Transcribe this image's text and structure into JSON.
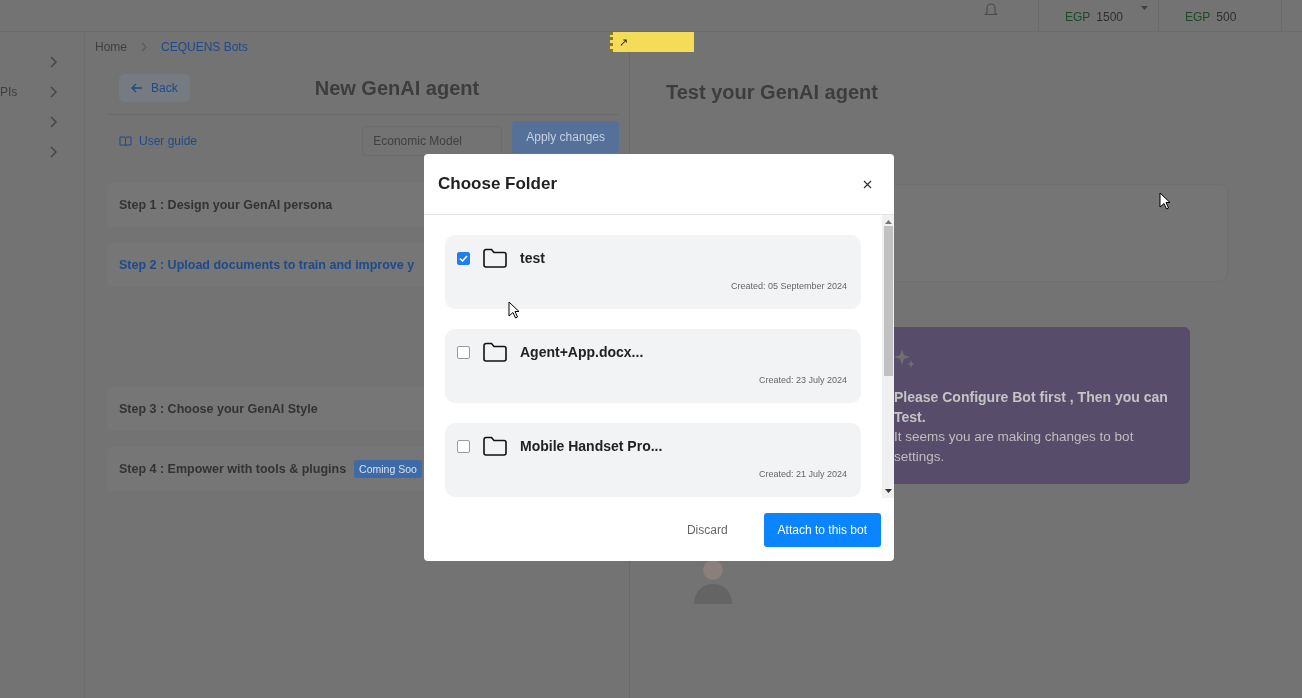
{
  "header": {
    "balances": [
      {
        "currency": "EGP",
        "amount": "1500",
        "dropdown": true
      },
      {
        "currency": "EGP",
        "amount": "500",
        "dropdown": false
      }
    ]
  },
  "sidebar": {
    "items": [
      {
        "kind": "chevron"
      },
      {
        "kind": "labeled",
        "label": "PIs"
      },
      {
        "kind": "chevron"
      },
      {
        "kind": "chevron"
      }
    ]
  },
  "sticky_note": {
    "text": "↗"
  },
  "breadcrumb": [
    {
      "label": "Home",
      "current": false
    },
    {
      "label": "CEQUENS Bots",
      "current": true
    }
  ],
  "editor": {
    "back": "Back",
    "title": "New GenAI agent",
    "user_guide": "User guide",
    "model": "Economic Model",
    "apply": "Apply changes",
    "steps": [
      {
        "label": "Step 1 : Design your GenAI persona",
        "active": false
      },
      {
        "label": "Step 2 : Upload documents to train and improve y",
        "active": true
      },
      {
        "label": "Step 3 : Choose your GenAI Style",
        "active": false
      },
      {
        "label": "Step 4 : Empower with tools & plugins",
        "active": false,
        "badge": "Coming Soo"
      }
    ]
  },
  "test_panel": {
    "title": "Test your GenAI agent",
    "notice": {
      "heading": "Please Configure Bot first , Then you can Test.",
      "body": "It seems you are making changes to bot settings."
    }
  },
  "dialog": {
    "title": "Choose Folder",
    "folders": [
      {
        "name": "test",
        "created": "Created: 05 September 2024",
        "checked": true
      },
      {
        "name": "Agent+App.docx...",
        "created": "Created: 23 July 2024",
        "checked": false
      },
      {
        "name": "Mobile Handset Pro...",
        "created": "Created: 21 July 2024",
        "checked": false
      }
    ],
    "buttons": [
      {
        "label": "Discard",
        "kind": "secondary"
      },
      {
        "label": "Attach to this bot",
        "kind": "primary"
      }
    ]
  }
}
